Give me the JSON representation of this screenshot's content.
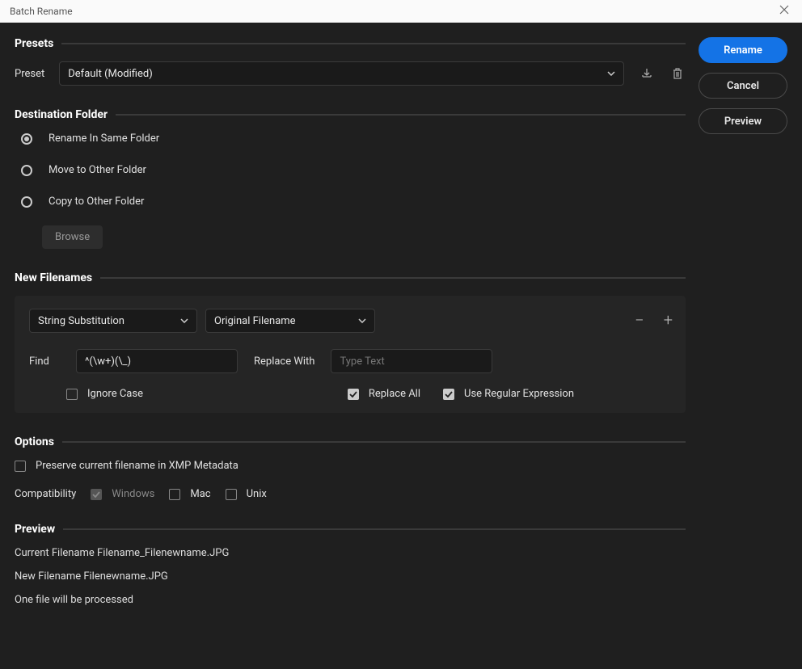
{
  "window": {
    "title": "Batch Rename"
  },
  "actions": {
    "rename": "Rename",
    "cancel": "Cancel",
    "preview": "Preview"
  },
  "presets": {
    "heading": "Presets",
    "label": "Preset",
    "value": "Default (Modified)"
  },
  "destination": {
    "heading": "Destination Folder",
    "options": [
      {
        "label": "Rename In Same Folder",
        "checked": true
      },
      {
        "label": "Move to Other Folder",
        "checked": false
      },
      {
        "label": "Copy to Other Folder",
        "checked": false
      }
    ],
    "browse": "Browse"
  },
  "filenames": {
    "heading": "New Filenames",
    "type": "String Substitution",
    "source": "Original Filename",
    "find_label": "Find",
    "find_value": "^(\\w+)(\\_)",
    "replace_label": "Replace With",
    "replace_placeholder": "Type Text",
    "ignore_case": "Ignore Case",
    "replace_all": "Replace All",
    "use_regex": "Use Regular Expression"
  },
  "options": {
    "heading": "Options",
    "preserve": "Preserve current filename in XMP Metadata",
    "compat_label": "Compatibility",
    "windows": "Windows",
    "mac": "Mac",
    "unix": "Unix"
  },
  "preview": {
    "heading": "Preview",
    "line1": "Current Filename Filename_Filenewname.JPG",
    "line2": "New Filename Filenewname.JPG",
    "line3": "One file will be processed"
  }
}
